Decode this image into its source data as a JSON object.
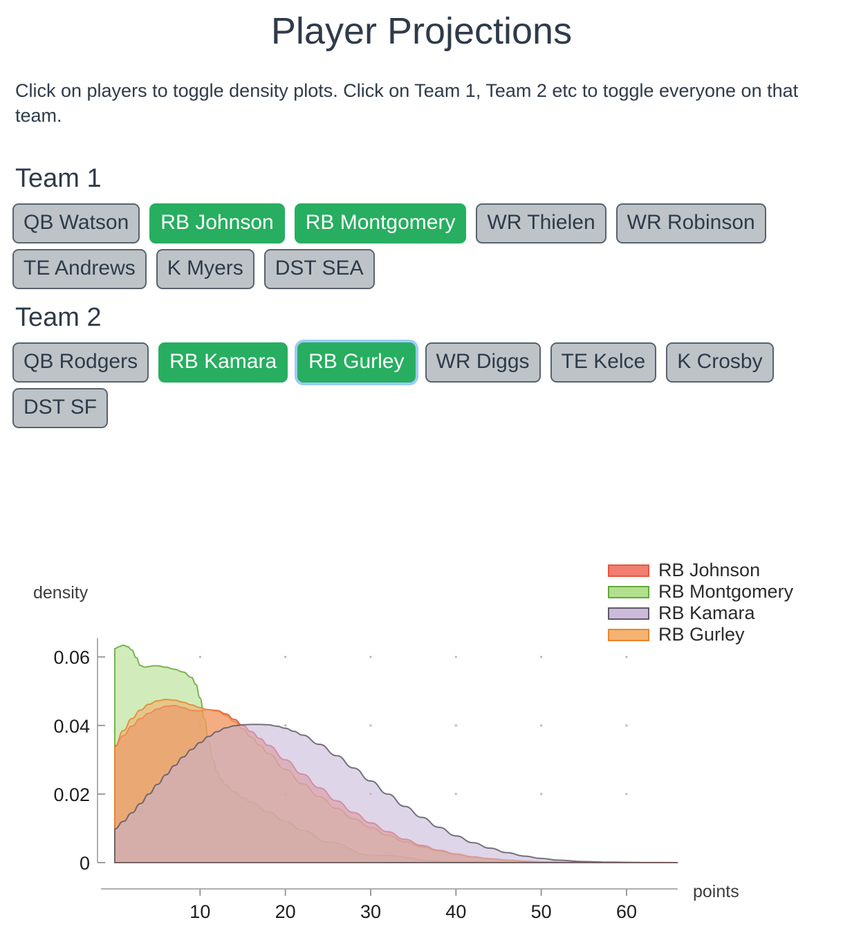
{
  "header": {
    "title": "Player Projections",
    "instructions": "Click on players to toggle density plots. Click on Team 1, Team 2 etc to toggle everyone on that team."
  },
  "teams": [
    {
      "name": "Team 1",
      "players": [
        {
          "label": "QB Watson",
          "active": false,
          "focused": false
        },
        {
          "label": "RB Johnson",
          "active": true,
          "focused": false
        },
        {
          "label": "RB Montgomery",
          "active": true,
          "focused": false
        },
        {
          "label": "WR Thielen",
          "active": false,
          "focused": false
        },
        {
          "label": "WR Robinson",
          "active": false,
          "focused": false
        },
        {
          "label": "TE Andrews",
          "active": false,
          "focused": false
        },
        {
          "label": "K Myers",
          "active": false,
          "focused": false
        },
        {
          "label": "DST SEA",
          "active": false,
          "focused": false
        }
      ]
    },
    {
      "name": "Team 2",
      "players": [
        {
          "label": "QB Rodgers",
          "active": false,
          "focused": false
        },
        {
          "label": "RB Kamara",
          "active": true,
          "focused": false
        },
        {
          "label": "RB Gurley",
          "active": true,
          "focused": true
        },
        {
          "label": "WR Diggs",
          "active": false,
          "focused": false
        },
        {
          "label": "TE Kelce",
          "active": false,
          "focused": false
        },
        {
          "label": "K Crosby",
          "active": false,
          "focused": false
        },
        {
          "label": "DST SF",
          "active": false,
          "focused": false
        }
      ]
    }
  ],
  "colors": {
    "chip_active": "#27ae60",
    "chip_inactive": "#bdc3c7",
    "chip_border": "#58636d",
    "focus_ring": "#9ecbf5",
    "text_dark": "#2f3b4a"
  },
  "chart_data": {
    "type": "area",
    "title": "",
    "xlabel": "points",
    "ylabel": "density",
    "xlim": [
      0,
      66
    ],
    "ylim": [
      0,
      0.068
    ],
    "xticks": [
      10,
      20,
      30,
      40,
      50,
      60
    ],
    "yticks": [
      0,
      0.02,
      0.04,
      0.06
    ],
    "ytick_labels": [
      "0",
      "0.02",
      "0.04",
      "0.06"
    ],
    "grid": "dots",
    "legend_position": "top-right",
    "fill_opacity": 0.55,
    "series": [
      {
        "name": "RB Johnson",
        "color": "#e8553f",
        "fill": "#ef7060",
        "x": [
          0,
          1,
          2,
          3,
          4,
          5,
          6,
          7,
          8,
          9,
          10,
          11,
          12,
          13,
          14,
          15,
          16,
          17,
          18,
          20,
          22,
          24,
          26,
          28,
          30,
          32,
          34,
          36,
          38,
          40,
          42,
          44,
          46,
          48,
          50,
          52,
          55,
          60,
          66
        ],
        "y": [
          0.034,
          0.037,
          0.0398,
          0.042,
          0.0436,
          0.0448,
          0.0456,
          0.0458,
          0.0452,
          0.0444,
          0.0443,
          0.0446,
          0.0444,
          0.0434,
          0.0418,
          0.04,
          0.0382,
          0.0362,
          0.0342,
          0.03,
          0.0258,
          0.0218,
          0.018,
          0.0146,
          0.0116,
          0.009,
          0.0068,
          0.005,
          0.0036,
          0.0025,
          0.0017,
          0.0011,
          0.0007,
          0.0004,
          0.0002,
          0.0001,
          4e-05,
          1e-05,
          0
        ]
      },
      {
        "name": "RB Montgomery",
        "color": "#63a83a",
        "fill": "#abdd82",
        "x": [
          0,
          0.5,
          1,
          1.5,
          2,
          2.5,
          3,
          3.5,
          4,
          4.5,
          5,
          6,
          7,
          8,
          9,
          9.5,
          10,
          10.5,
          11,
          11.5,
          12,
          12.5,
          13,
          14,
          15,
          16,
          18,
          20,
          22,
          25,
          30,
          40,
          50,
          66
        ],
        "y": [
          0.0624,
          0.063,
          0.0634,
          0.063,
          0.062,
          0.0598,
          0.0575,
          0.057,
          0.0572,
          0.0574,
          0.0574,
          0.057,
          0.0564,
          0.0556,
          0.054,
          0.052,
          0.048,
          0.042,
          0.0355,
          0.03,
          0.0265,
          0.0242,
          0.0226,
          0.0206,
          0.019,
          0.0176,
          0.0148,
          0.012,
          0.0094,
          0.006,
          0.0022,
          0.0002,
          2e-05,
          0
        ]
      },
      {
        "name": "RB Kamara",
        "color": "#5f5a66",
        "fill": "#c5b3d6",
        "x": [
          0,
          1,
          2,
          3,
          4,
          5,
          6,
          7,
          8,
          9,
          10,
          11,
          12,
          13,
          14,
          15,
          16,
          17,
          18,
          19,
          20,
          21,
          22,
          24,
          26,
          28,
          30,
          32,
          34,
          36,
          38,
          40,
          42,
          44,
          46,
          48,
          50,
          52,
          55,
          58,
          62,
          66
        ],
        "y": [
          0.0098,
          0.012,
          0.0145,
          0.0172,
          0.02,
          0.0228,
          0.0256,
          0.0283,
          0.0308,
          0.033,
          0.035,
          0.0368,
          0.0382,
          0.0393,
          0.0399,
          0.0402,
          0.0403,
          0.0403,
          0.0402,
          0.0398,
          0.0392,
          0.0383,
          0.0372,
          0.0345,
          0.0312,
          0.0276,
          0.0238,
          0.02,
          0.0164,
          0.0132,
          0.0103,
          0.0078,
          0.0058,
          0.0042,
          0.0029,
          0.0019,
          0.0012,
          0.0007,
          0.0003,
          0.00012,
          3e-05,
          0
        ]
      },
      {
        "name": "RB Gurley",
        "color": "#e8862e",
        "fill": "#f3ab63",
        "x": [
          0,
          1,
          2,
          3,
          4,
          5,
          6,
          7,
          8,
          9,
          10,
          11,
          12,
          13,
          14,
          15,
          16,
          17,
          18,
          20,
          22,
          24,
          26,
          28,
          30,
          32,
          34,
          36,
          38,
          40,
          42,
          44,
          46,
          48,
          50,
          52,
          55,
          60,
          66
        ],
        "y": [
          0.0338,
          0.0385,
          0.042,
          0.0445,
          0.0462,
          0.0472,
          0.0476,
          0.0474,
          0.0468,
          0.046,
          0.0452,
          0.0446,
          0.0442,
          0.043,
          0.0412,
          0.039,
          0.0366,
          0.0342,
          0.0318,
          0.0272,
          0.023,
          0.0192,
          0.0158,
          0.0128,
          0.0102,
          0.008,
          0.0061,
          0.0046,
          0.0034,
          0.0024,
          0.0016,
          0.0011,
          0.0007,
          0.0004,
          0.0002,
          0.0001,
          4e-05,
          1e-05,
          0
        ]
      }
    ]
  }
}
